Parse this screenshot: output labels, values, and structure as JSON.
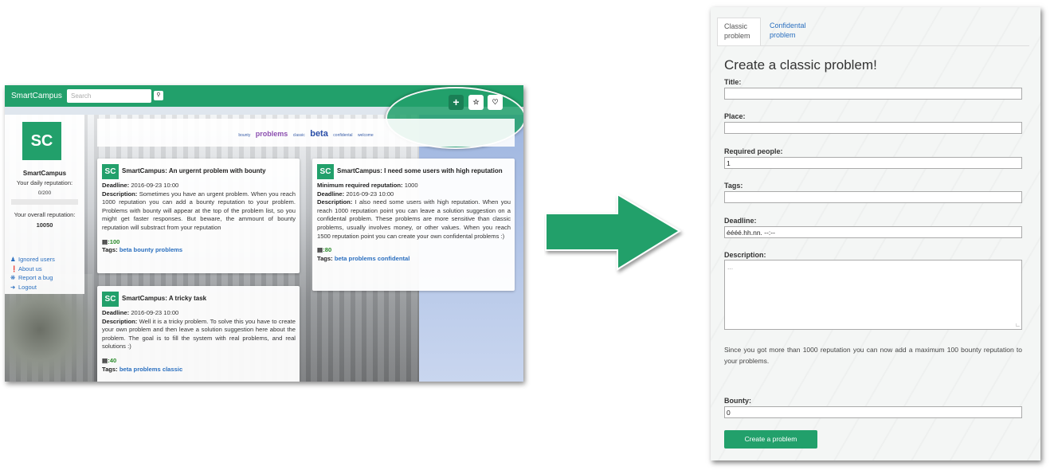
{
  "left": {
    "brand": "SmartCampus",
    "search_placeholder": "Search",
    "search_icon": "search-icon",
    "nav_icons": [
      "plus-icon",
      "star-icon",
      "bell-icon"
    ],
    "sidebar": {
      "avatar": "SC",
      "name": "SmartCampus",
      "daily_label": "Your daily reputation:",
      "daily_value": "0/200",
      "overall_label": "Your overall reputation:",
      "overall_value": "10050",
      "links": [
        {
          "icon": "users-icon",
          "label": "Ignored users"
        },
        {
          "icon": "info-icon",
          "label": "About us"
        },
        {
          "icon": "bug-icon",
          "label": "Report a bug"
        },
        {
          "icon": "logout-icon",
          "label": "Logout"
        }
      ]
    },
    "tagcloud": [
      "bounty",
      "problems",
      "classic",
      "beta",
      "confidental",
      "welcome"
    ],
    "cards": [
      {
        "avatar": "SC",
        "title": "SmartCampus: An urgernt problem with bounty",
        "deadline_label": "Deadline:",
        "deadline": "2016-09-23 10:00",
        "desc_label": "Description:",
        "desc": "Sometimes you have an urgent problem. When you reach 1000 reputation you can add a bounty reputation to your problem. Problems with bounty will appear at the top of the problem list, so you might get faster responses. But beware, the ammount of bounty reputation will substract from your reputation",
        "bounty": "100",
        "tags_label": "Tags:",
        "tags": "beta bounty problems"
      },
      {
        "avatar": "SC",
        "title": "SmartCampus: I need some users with high reputation",
        "min_label": "Minimum required reputation:",
        "min_value": "1000",
        "deadline_label": "Deadline:",
        "deadline": "2016-09-23 10:00",
        "desc_label": "Description:",
        "desc": "I also need some users with high reputation. When you reach 1000 reputation point you can leave a solution suggestion on a confidental problem. These problems are more sensitive than classic problems, usually involves money, or other values. When you reach 1500 reputation point you can create your own confidental problems :)",
        "bounty": "80",
        "tags_label": "Tags:",
        "tags": "beta problems confidental"
      },
      {
        "avatar": "SC",
        "title": "SmartCampus: A tricky task",
        "deadline_label": "Deadline:",
        "deadline": "2016-09-23 10:00",
        "desc_label": "Description:",
        "desc": "Well it is a tricky problem. To solve this you have to create your own problem and then leave a solution suggestion here about the problem. The goal is to fill the system with real problems, and real solutions :)",
        "bounty": "40",
        "tags_label": "Tags:",
        "tags": "beta problems classic"
      }
    ]
  },
  "arrow_icon": "right-arrow-icon",
  "form": {
    "tabs": [
      "Classic problem",
      "Confidental problem"
    ],
    "heading": "Create a classic problem!",
    "fields": {
      "title_label": "Title:",
      "title_value": "",
      "place_label": "Place:",
      "place_value": "",
      "people_label": "Required people:",
      "people_value": "1",
      "tags_label": "Tags:",
      "tags_value": "",
      "deadline_label": "Deadline:",
      "deadline_value": "éééé.hh.nn. --:--",
      "description_label": "Description:",
      "description_placeholder": "...",
      "bounty_label": "Bounty:",
      "bounty_value": "0"
    },
    "note": "Since you got more than 1000 reputation you can now add a maximum 100 bounty reputation to your problems.",
    "submit": "Create a problem"
  },
  "colors": {
    "brand_green": "#22a06b",
    "link_blue": "#2a6fbf"
  }
}
